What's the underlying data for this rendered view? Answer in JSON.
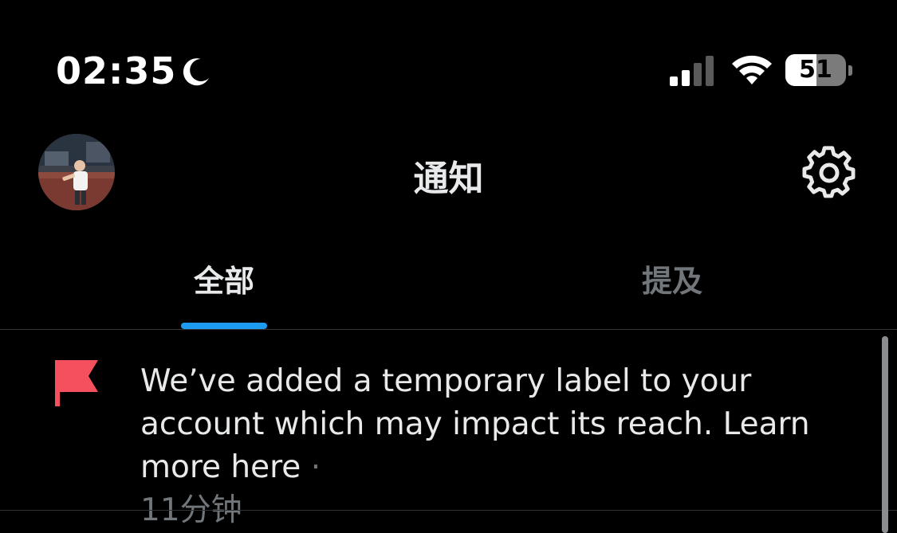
{
  "status_bar": {
    "time": "02:35",
    "battery_level": "51",
    "battery_fraction": 0.51,
    "focus_mode_icon": "moon-icon",
    "signal_icon": "cellular-signal-icon",
    "wifi_icon": "wifi-icon"
  },
  "header": {
    "title": "通知",
    "avatar_icon": "profile-avatar",
    "settings_icon": "gear-icon"
  },
  "tabs": [
    {
      "label": "全部",
      "selected": true
    },
    {
      "label": "提及",
      "selected": false
    }
  ],
  "notifications": [
    {
      "icon": "flag-icon",
      "text": "We’ve added a temporary label to your account which may impact its reach. Learn more here",
      "separator": "·",
      "time": "11分钟"
    }
  ],
  "colors": {
    "background": "#000000",
    "accent": "#1d9bf0",
    "flag": "#f4505e",
    "muted_text": "#71767b"
  }
}
